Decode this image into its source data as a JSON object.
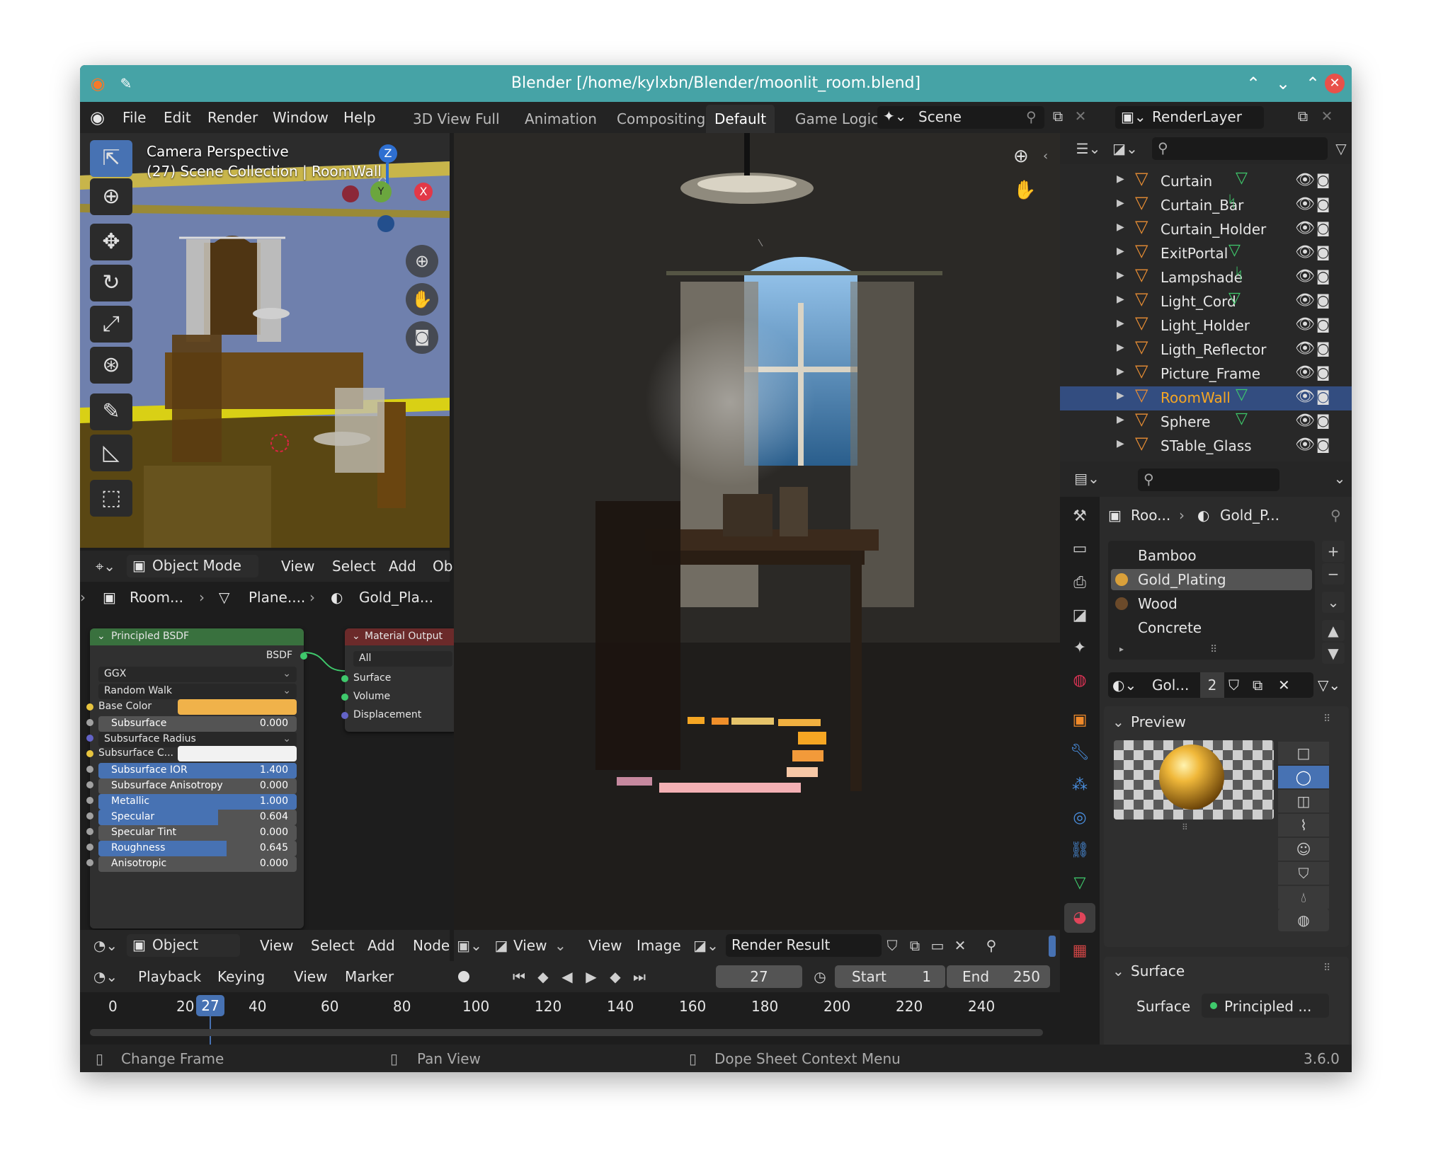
{
  "window": {
    "title": "Blender [/home/kylxbn/Blender/moonlit_room.blend]",
    "version": "3.6.0"
  },
  "menubar": {
    "items": [
      "File",
      "Edit",
      "Render",
      "Window",
      "Help"
    ],
    "workspaces": [
      "3D View Full",
      "Animation",
      "Compositing",
      "Default",
      "Game Logic"
    ],
    "active_workspace": "Default",
    "scene": "Scene",
    "view_layer": "RenderLayer"
  },
  "viewport": {
    "line1": "Camera Perspective",
    "line2": "(27) Scene Collection | RoomWall",
    "gizmo": {
      "z": "Z",
      "x": "X",
      "y": "Y"
    },
    "header": {
      "mode": "Object Mode",
      "menus": [
        "View",
        "Select",
        "Add",
        "Ob"
      ]
    }
  },
  "node_editor": {
    "breadcrumb": [
      "Room...",
      "Plane....",
      "Gold_Pla..."
    ],
    "bsdf": {
      "title": "Principled BSDF",
      "output": "BSDF",
      "dropdowns": [
        "GGX",
        "Random Walk"
      ],
      "base_color_label": "Base Color",
      "subsurface_color_label": "Subsurface C...",
      "sliders": [
        {
          "label": "Subsurface",
          "value": "0.000",
          "fill": 0
        },
        {
          "label": "Subsurface IOR",
          "value": "1.400",
          "fill": 1
        },
        {
          "label": "Subsurface Anisotropy",
          "value": "0.000",
          "fill": 0
        },
        {
          "label": "Metallic",
          "value": "1.000",
          "fill": 1
        },
        {
          "label": "Specular",
          "value": "0.604",
          "fill": 0.604
        },
        {
          "label": "Specular Tint",
          "value": "0.000",
          "fill": 0
        },
        {
          "label": "Roughness",
          "value": "0.645",
          "fill": 0.645
        },
        {
          "label": "Anisotropic",
          "value": "0.000",
          "fill": 0
        }
      ],
      "radius_dropdown": "Subsurface Radius"
    },
    "output": {
      "title": "Material Output",
      "target": "All",
      "inputs": [
        "Surface",
        "Volume",
        "Displacement"
      ]
    },
    "header": {
      "mode": "Object",
      "menus": [
        "View",
        "Select",
        "Add",
        "Node"
      ]
    }
  },
  "image_editor": {
    "menus": [
      "View",
      "View",
      "Image"
    ],
    "image_name": "Render Result"
  },
  "timeline": {
    "menus": [
      "Playback",
      "Keying",
      "View",
      "Marker"
    ],
    "current_frame": "27",
    "start_label": "Start",
    "start": "1",
    "end_label": "End",
    "end": "250",
    "ticks": [
      "0",
      "20",
      "40",
      "60",
      "80",
      "100",
      "120",
      "140",
      "160",
      "180",
      "200",
      "220",
      "240"
    ]
  },
  "outliner": {
    "items": [
      {
        "name": "Curtain",
        "mod": "vertex",
        "selected": false
      },
      {
        "name": "Curtain_Bar",
        "mod": "bone",
        "selected": false
      },
      {
        "name": "Curtain_Holder",
        "mod": "",
        "selected": false
      },
      {
        "name": "ExitPortal",
        "mod": "vertex",
        "selected": false
      },
      {
        "name": "Lampshade",
        "mod": "bone",
        "selected": false
      },
      {
        "name": "Light_Cord",
        "mod": "vertex",
        "selected": false
      },
      {
        "name": "Light_Holder",
        "mod": "",
        "selected": false
      },
      {
        "name": "Ligth_Reflector",
        "mod": "",
        "selected": false
      },
      {
        "name": "Picture_Frame",
        "mod": "",
        "selected": false
      },
      {
        "name": "RoomWall",
        "mod": "vertex",
        "selected": true
      },
      {
        "name": "Sphere",
        "mod": "vertex",
        "selected": false
      },
      {
        "name": "STable_Glass",
        "mod": "",
        "selected": false
      }
    ]
  },
  "properties": {
    "breadcrumb": [
      "Roo...",
      "Gold_P..."
    ],
    "materials": [
      {
        "name": "Bamboo",
        "swatch": ""
      },
      {
        "name": "Gold_Plating",
        "swatch": "#d9a03a"
      },
      {
        "name": "Wood",
        "swatch": "#6b4a2a"
      },
      {
        "name": "Concrete",
        "swatch": ""
      }
    ],
    "active_material": "Gold_Plating",
    "material_short": "Gol...",
    "users": "2",
    "preview_label": "Preview",
    "surface_label": "Surface",
    "surface_field_label": "Surface",
    "surface_value": "Principled ..."
  },
  "statusbar": {
    "items": [
      "Change Frame",
      "Pan View",
      "Dope Sheet Context Menu"
    ]
  },
  "colors": {
    "titlebar": "#46a3a6",
    "selection": "#334d80",
    "accent": "#4772b3",
    "highlight_text": "#f5a623",
    "mesh_icon": "#e98e34",
    "modifier_icon": "#3fc96c"
  }
}
